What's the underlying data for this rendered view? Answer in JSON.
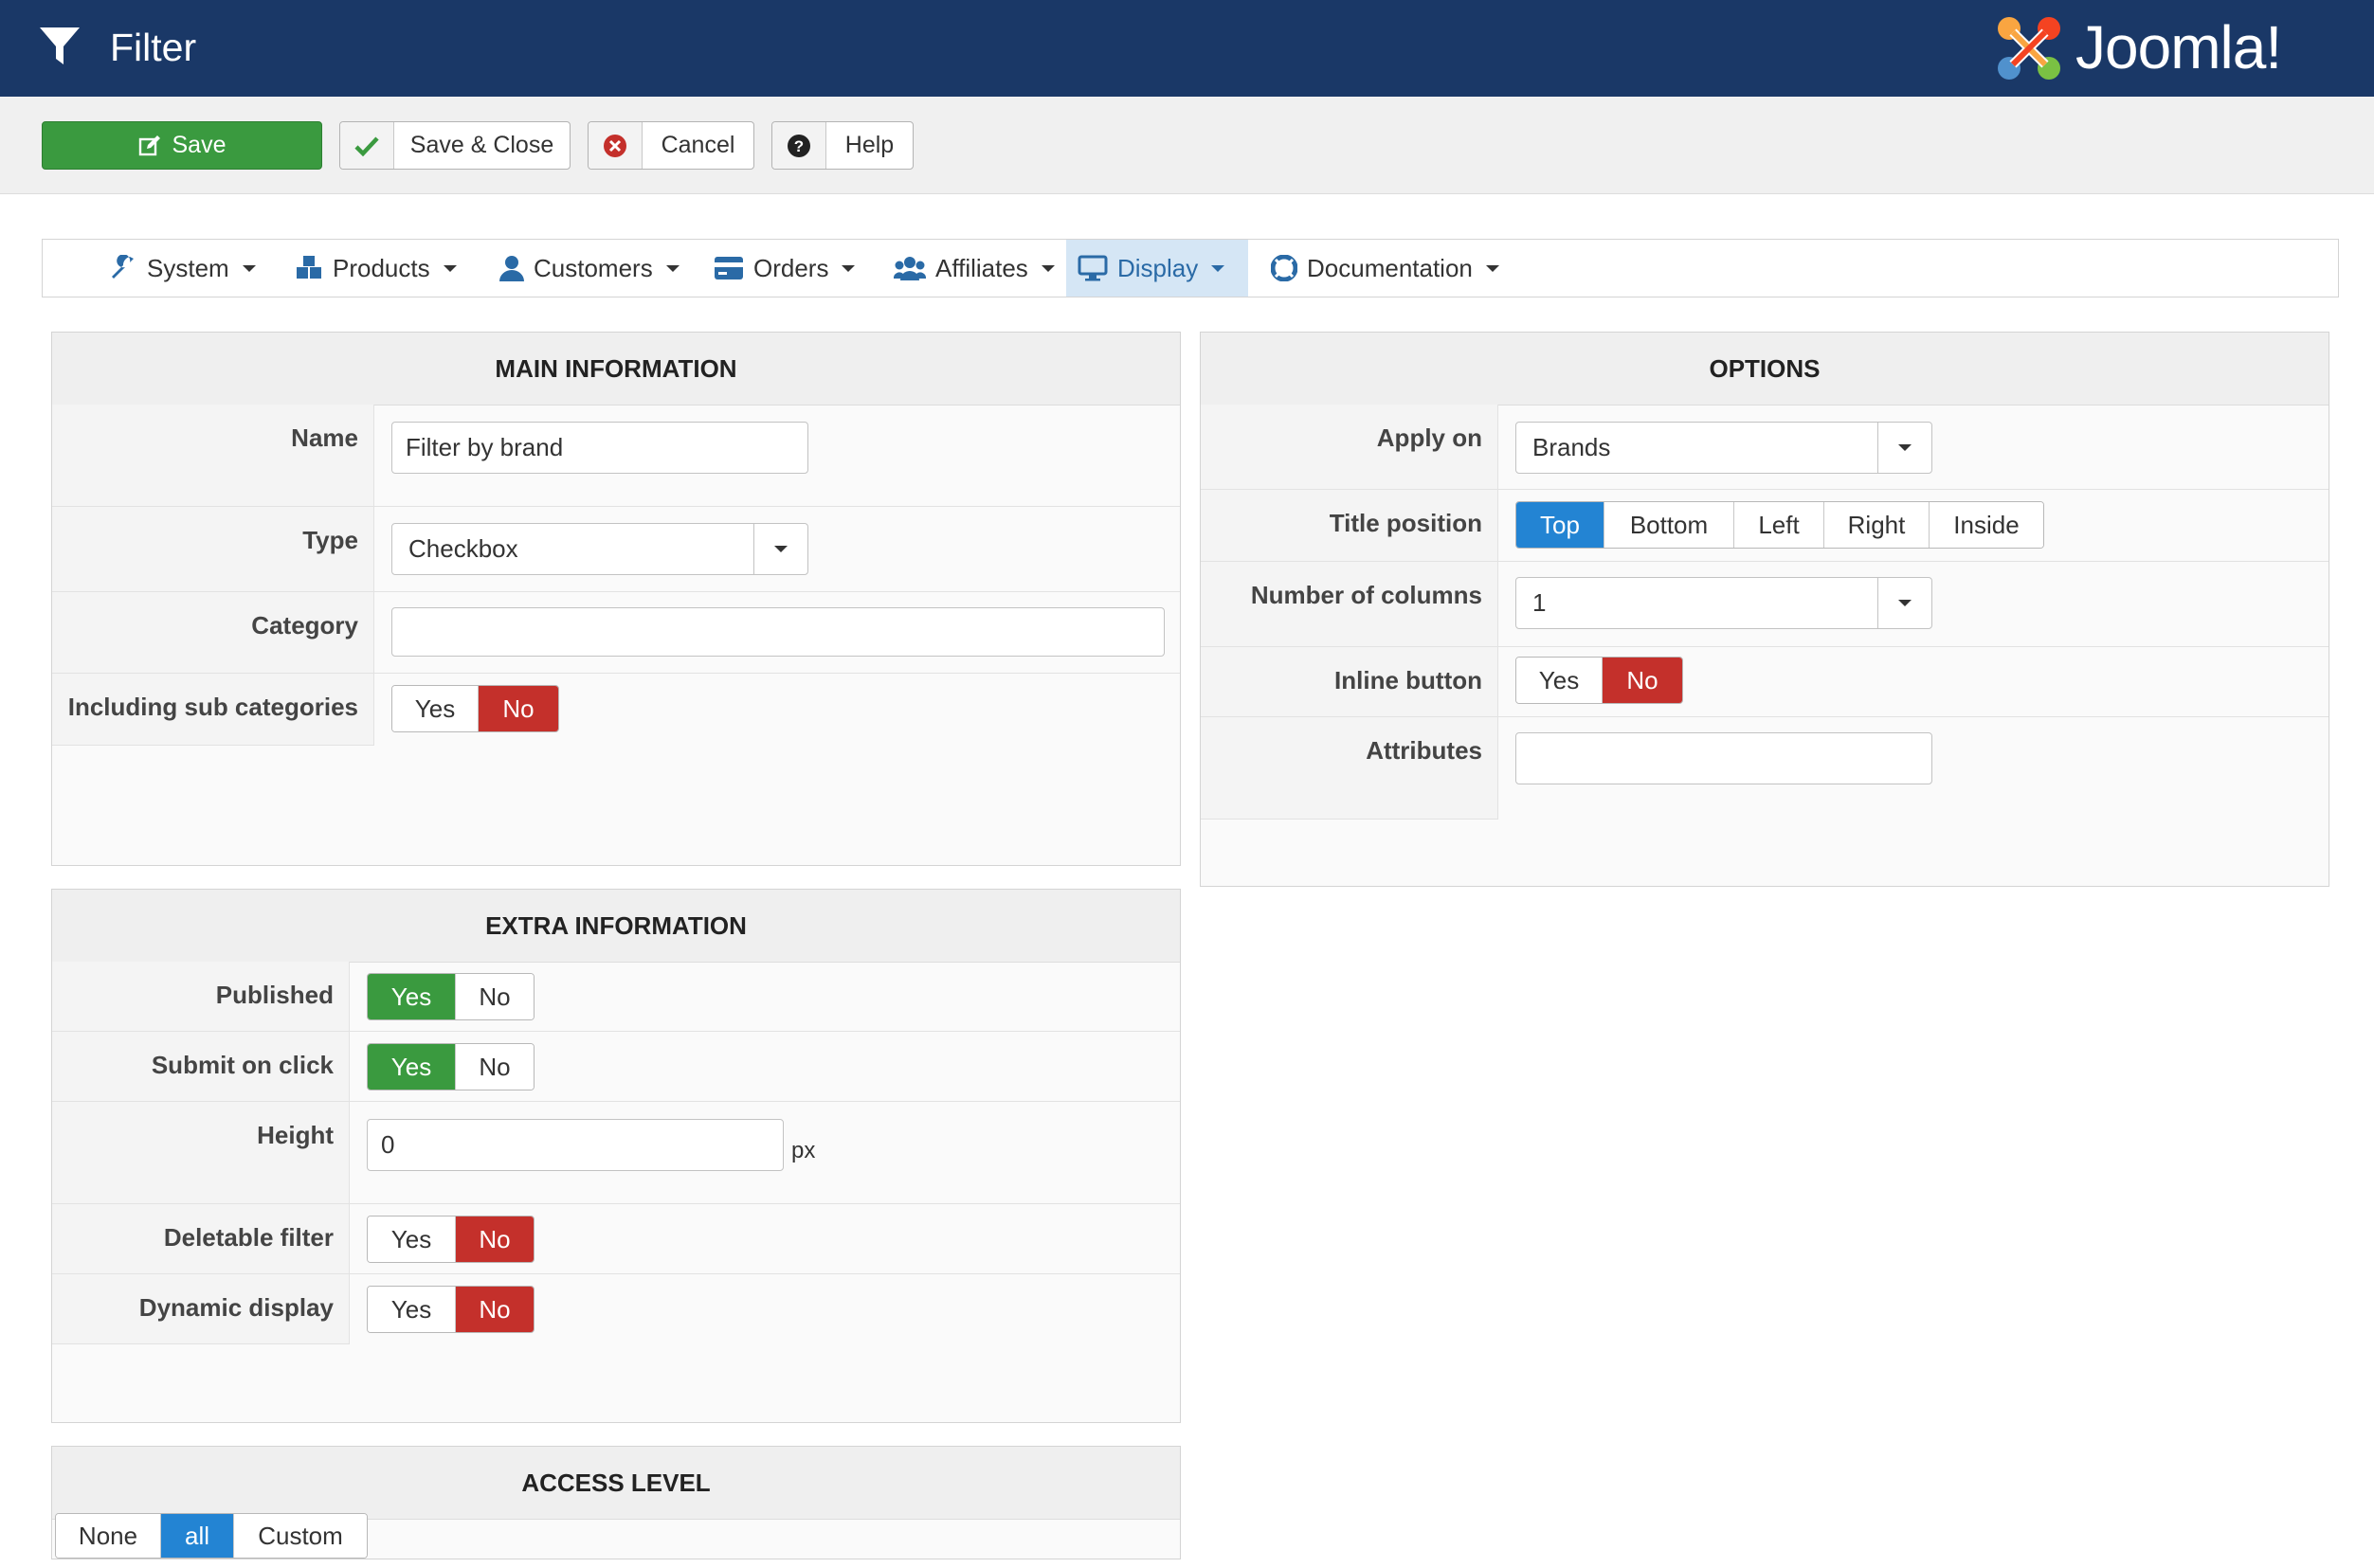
{
  "header": {
    "title": "Filter",
    "logo_text": "Joomla!",
    "icon": "filter-icon"
  },
  "toolbar": {
    "save_label": "Save",
    "save_close_label": "Save & Close",
    "cancel_label": "Cancel",
    "help_label": "Help"
  },
  "nav": {
    "items": [
      {
        "label": "System",
        "icon": "wrench-icon"
      },
      {
        "label": "Products",
        "icon": "cubes-icon"
      },
      {
        "label": "Customers",
        "icon": "user-icon"
      },
      {
        "label": "Orders",
        "icon": "credit-card-icon"
      },
      {
        "label": "Affiliates",
        "icon": "users-icon"
      },
      {
        "label": "Display",
        "icon": "monitor-icon"
      },
      {
        "label": "Documentation",
        "icon": "lifebuoy-icon"
      }
    ],
    "active": "Display"
  },
  "main_info": {
    "title": "MAIN INFORMATION",
    "name_label": "Name",
    "name_value": "Filter by brand",
    "type_label": "Type",
    "type_value": "Checkbox",
    "category_label": "Category",
    "category_value": "",
    "sub_label": "Including sub categories",
    "sub_yes": "Yes",
    "sub_no": "No",
    "sub_selected": "No"
  },
  "options": {
    "title": "OPTIONS",
    "apply_label": "Apply on",
    "apply_value": "Brands",
    "title_pos_label": "Title position",
    "title_pos_options": [
      "Top",
      "Bottom",
      "Left",
      "Right",
      "Inside"
    ],
    "title_pos_selected": "Top",
    "columns_label": "Number of columns",
    "columns_value": "1",
    "inline_label": "Inline button",
    "inline_yes": "Yes",
    "inline_no": "No",
    "inline_selected": "No",
    "attributes_label": "Attributes",
    "attributes_value": ""
  },
  "extra_info": {
    "title": "EXTRA INFORMATION",
    "published_label": "Published",
    "published_selected": "Yes",
    "submit_label": "Submit on click",
    "submit_selected": "Yes",
    "height_label": "Height",
    "height_value": "0",
    "height_unit": "px",
    "deletable_label": "Deletable filter",
    "deletable_selected": "No",
    "dynamic_label": "Dynamic display",
    "dynamic_selected": "No",
    "yes": "Yes",
    "no": "No"
  },
  "access": {
    "title": "ACCESS LEVEL",
    "options": [
      "None",
      "all",
      "Custom"
    ],
    "selected": "all"
  },
  "colors": {
    "header_bg": "#1a3867",
    "save_green": "#3a9a3f",
    "no_red": "#c4302b",
    "active_blue": "#2384d3"
  }
}
